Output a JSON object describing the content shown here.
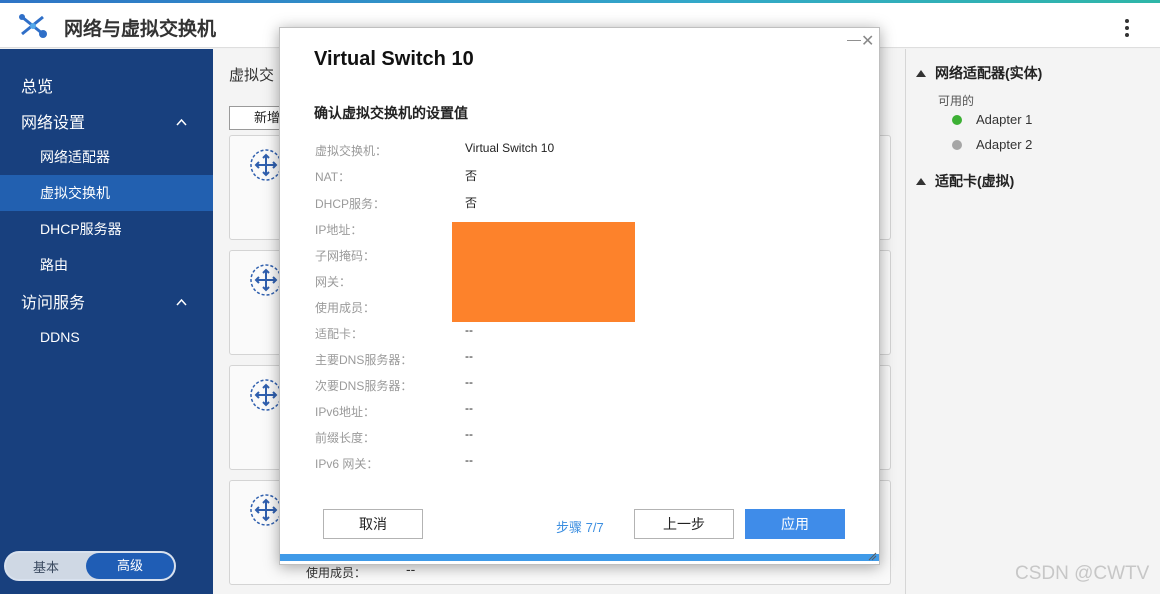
{
  "app": {
    "title": "网络与虚拟交换机"
  },
  "sidebar": {
    "overview": "总览",
    "network_settings": "网络设置",
    "network_items": [
      "网络适配器",
      "虚拟交换机",
      "DHCP服务器",
      "路由"
    ],
    "access_services": "访问服务",
    "access_items": [
      "DDNS"
    ],
    "mode_basic": "基本",
    "mode_advanced": "高级"
  },
  "center": {
    "title_partial": "虚拟交",
    "new_button_partial": "新增",
    "member_label": "使用成员：",
    "member_value": "--"
  },
  "right_panel": {
    "physical_header": "网络适配器(实体)",
    "available_label": "可用的",
    "adapters": [
      {
        "name": "Adapter 1",
        "status_color": "#3cb034"
      },
      {
        "name": "Adapter 2",
        "status_color": "#a6a6a6"
      }
    ],
    "virtual_header": "适配卡(虚拟)"
  },
  "modal": {
    "title": "Virtual Switch 10",
    "subtitle": "确认虚拟交换机的设置值",
    "rows": [
      {
        "label": "虚拟交换机：",
        "value": "Virtual Switch 10"
      },
      {
        "label": "NAT：",
        "value": "否"
      },
      {
        "label": "DHCP服务：",
        "value": "否"
      },
      {
        "label": "IP地址：",
        "value": ""
      },
      {
        "label": "子网掩码：",
        "value": ""
      },
      {
        "label": "网关：",
        "value": ""
      },
      {
        "label": "使用成员：",
        "value": ""
      },
      {
        "label": "适配卡：",
        "value": "--"
      },
      {
        "label": "主要DNS服务器：",
        "value": "--"
      },
      {
        "label": "次要DNS服务器：",
        "value": "--"
      },
      {
        "label": "IPv6地址：",
        "value": "--"
      },
      {
        "label": "前缀长度：",
        "value": "--"
      },
      {
        "label": "IPv6 网关：",
        "value": "--"
      }
    ],
    "cancel": "取消",
    "step": "步骤 7/7",
    "prev": "上一步",
    "apply": "应用",
    "progress": 1.0
  },
  "watermark": "CSDN @CWTV",
  "colors": {
    "sidebar": "#18407e",
    "active": "#2260b0",
    "accent": "#3f8ce9",
    "redaction": "#fd822b"
  }
}
